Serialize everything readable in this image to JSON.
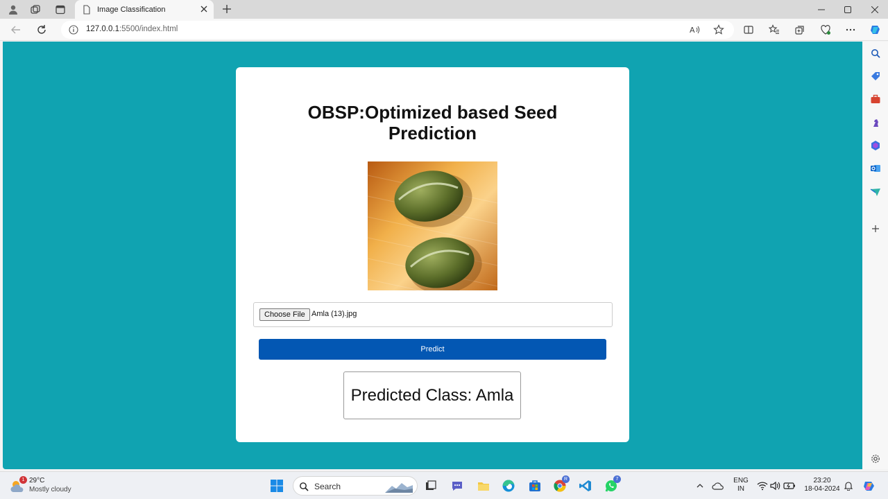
{
  "browser": {
    "tab_title": "Image Classification",
    "url_host": "127.0.0.1",
    "url_rest": ":5500/index.html"
  },
  "page": {
    "heading_line1": "OBSP:Optimized based Seed",
    "heading_line2": "Prediction",
    "choose_file_label": "Choose File",
    "selected_file": "Amla (13).jpg",
    "predict_label": "Predict",
    "result_text": "Predicted Class: Amla",
    "background_color": "#10a3b1",
    "button_color": "#0357b3"
  },
  "taskbar": {
    "weather_temp": "29°C",
    "weather_desc": "Mostly cloudy",
    "weather_badge": "1",
    "search_label": "Search",
    "lang_line1": "ENG",
    "lang_line2": "IN",
    "time": "23:20",
    "date": "18-04-2024",
    "whatsapp_badge": "7"
  }
}
